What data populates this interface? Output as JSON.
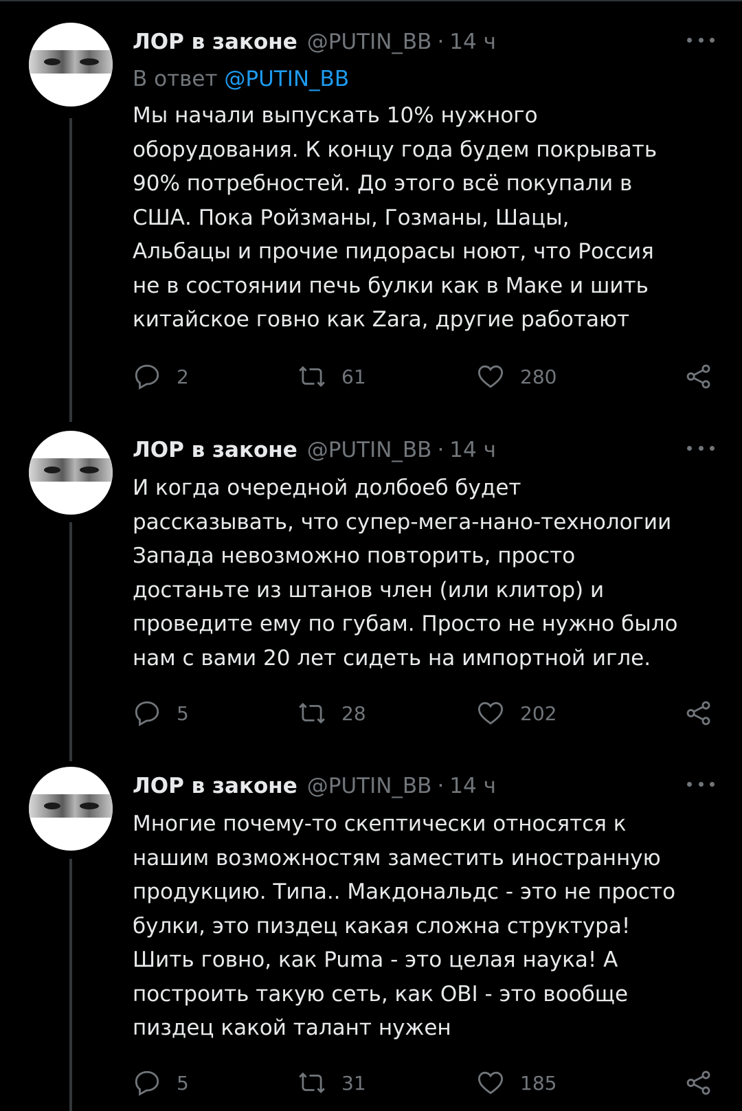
{
  "tweets": [
    {
      "name": "ЛОР в законе",
      "handle": "@PUTIN_BB",
      "dot": "·",
      "time": "14 ч",
      "reply_prefix": "В ответ",
      "reply_handle": "@PUTIN_BB",
      "lines": [
        "Мы начали выпускать 10% нужного",
        "оборудования. К концу года будем покрывать",
        "90% потребностей. До этого всё покупали в",
        "США. Пока Ройзманы, Гозманы, Шацы,",
        "Альбацы и прочие пидорасы ноют, что Россия",
        "не в состоянии печь булки как в Маке и шить",
        "китайское говно как Zara, другие работают"
      ],
      "replies": "2",
      "retweets": "61",
      "likes": "280"
    },
    {
      "name": "ЛОР в законе",
      "handle": "@PUTIN_BB",
      "dot": "·",
      "time": "14 ч",
      "lines": [
        "И когда очередной долбоеб будет",
        "рассказывать, что супер-мега-нано-технологии",
        "Запада невозможно повторить, просто",
        "достаньте из штанов член (или клитор) и",
        "проведите ему по губам. Просто не нужно было",
        "нам с вами 20 лет сидеть на импортной игле."
      ],
      "replies": "5",
      "retweets": "28",
      "likes": "202"
    },
    {
      "name": "ЛОР в законе",
      "handle": "@PUTIN_BB",
      "dot": "·",
      "time": "14 ч",
      "lines": [
        "Многие почему-то скептически относятся к",
        "нашим возможностям заместить иностранную",
        "продукцию. Типа.. Макдональдс - это не просто",
        "булки, это пиздец какая сложна структура!",
        "Шить говно, как Puma - это целая наука! А",
        "построить такую сеть, как OBI - это вообще",
        "пиздец какой талант нужен"
      ],
      "replies": "5",
      "retweets": "31",
      "likes": "185"
    }
  ]
}
